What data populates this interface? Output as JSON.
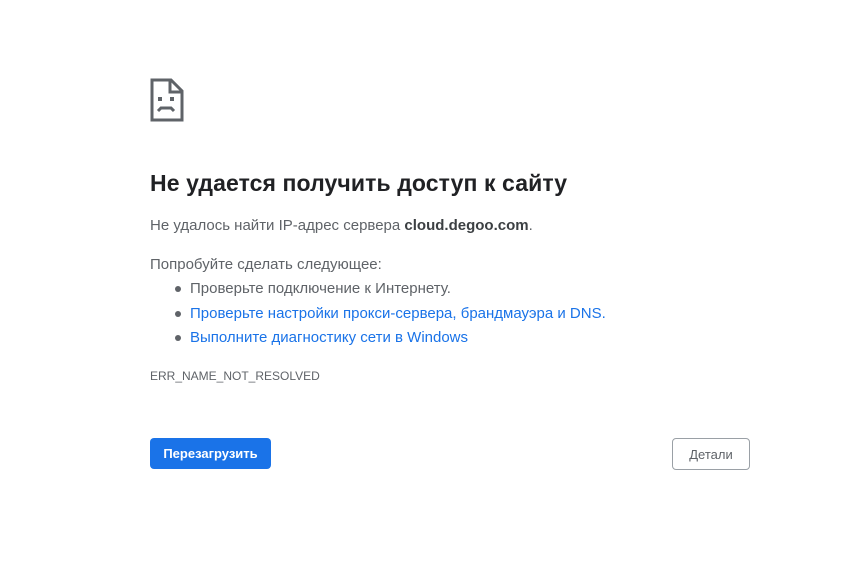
{
  "error": {
    "icon": "sad-page-icon",
    "heading": "Не удается получить доступ к сайту",
    "summary_prefix": "Не удалось найти IP-адрес сервера ",
    "summary_host": "cloud.degoo.com",
    "summary_suffix": ".",
    "suggestions_title": "Попробуйте сделать следующее:",
    "suggestions": [
      "Проверьте подключение к Интернету.",
      "Проверьте настройки прокси-сервера, брандмауэра и DNS.",
      "Выполните диагностику сети в Windows"
    ],
    "error_code": "ERR_NAME_NOT_RESOLVED"
  },
  "buttons": {
    "reload_label": "Перезагрузить",
    "details_label": "Детали"
  },
  "colors": {
    "accent": "#1a73e8",
    "text_primary": "#202124",
    "text_secondary": "#5f6368"
  }
}
